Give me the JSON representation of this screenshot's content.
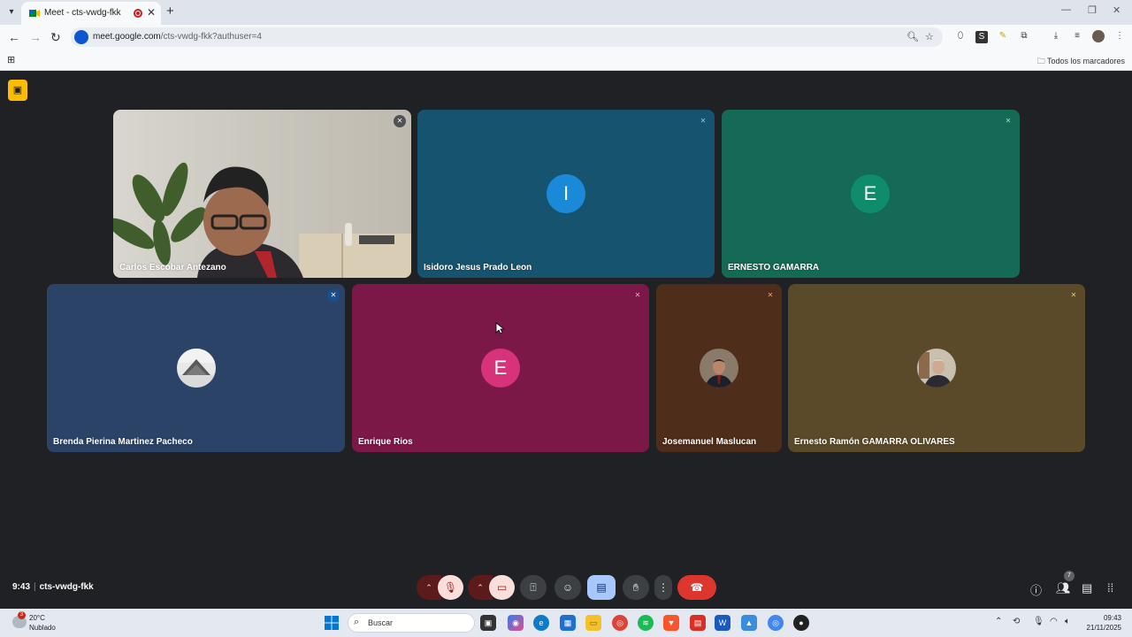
{
  "browser": {
    "tab_title": "Meet - cts-vwdg-fkk",
    "url_host": "meet.google.com",
    "url_path": "/cts-vwdg-fkk?authuser=4",
    "bookmarks_label": "Todos los marcadores"
  },
  "meeting": {
    "time": "9:43",
    "code": "cts-vwdg-fkk",
    "people_count": "7",
    "participants": [
      {
        "name": "Carlos Escobar Antezano",
        "tile_color": "#c9c6bd"
      },
      {
        "name": "Isidoro Jesus Prado Leon",
        "tile_color": "#16536f",
        "initial": "I",
        "avatar_color": "#1a8ad8"
      },
      {
        "name": "ERNESTO GAMARRA",
        "tile_color": "#146a55",
        "initial": "E",
        "avatar_color": "#0e8c6b"
      },
      {
        "name": "Brenda Pierina Martinez Pacheco",
        "tile_color": "#2c4368"
      },
      {
        "name": "Enrique Rios",
        "tile_color": "#7c1848",
        "initial": "E",
        "avatar_color": "#d6337a"
      },
      {
        "name": "Josemanuel Maslucan",
        "tile_color": "#4e2d1a"
      },
      {
        "name": "Ernesto Ramón GAMARRA OLIVARES",
        "tile_color": "#5b4a2a"
      }
    ]
  },
  "taskbar": {
    "temperature": "20°C",
    "weather": "Nublado",
    "weather_badge": "3",
    "search_placeholder": "Buscar",
    "clock_time": "09:43",
    "clock_date": "21/11/2025"
  }
}
